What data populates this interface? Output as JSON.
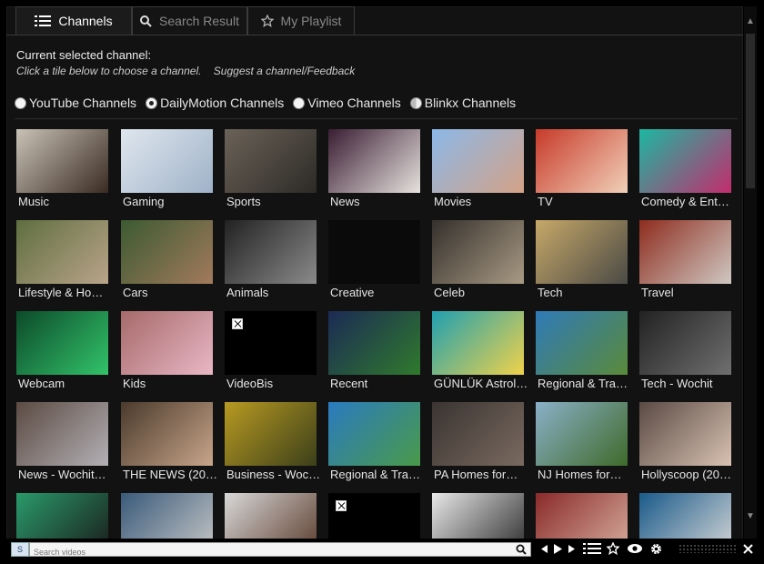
{
  "tabs": [
    {
      "label": "Channels",
      "icon": "list-icon",
      "active": true
    },
    {
      "label": "Search Result",
      "icon": "search-icon",
      "active": false
    },
    {
      "label": "My Playlist",
      "icon": "star-icon",
      "active": false
    }
  ],
  "header": {
    "current_label": "Current selected channel:",
    "hint": "Click a tile below to choose a channel.",
    "suggest_link": "Suggest a channel/Feedback"
  },
  "sources": [
    {
      "label": "YouTube Channels",
      "selected": false
    },
    {
      "label": "DailyMotion Channels",
      "selected": true
    },
    {
      "label": "Vimeo Channels",
      "selected": false
    },
    {
      "label": "Blinkx Channels",
      "selected": false
    }
  ],
  "tiles": [
    {
      "label": "Music",
      "colors": [
        "#c9c2b6",
        "#3a2b22"
      ]
    },
    {
      "label": "Gaming",
      "colors": [
        "#dfe6ee",
        "#9fb2c8"
      ]
    },
    {
      "label": "Sports",
      "colors": [
        "#6b6258",
        "#2c2a26"
      ]
    },
    {
      "label": "News",
      "colors": [
        "#3a1d33",
        "#e6e2de"
      ]
    },
    {
      "label": "Movies",
      "colors": [
        "#8cb8e8",
        "#d4a287"
      ]
    },
    {
      "label": "TV",
      "colors": [
        "#c73a2a",
        "#f1d0b8"
      ]
    },
    {
      "label": "Comedy & Ent…",
      "colors": [
        "#1bb8a2",
        "#c32c6d"
      ]
    },
    {
      "label": "Lifestyle & Ho…",
      "colors": [
        "#5f6e3f",
        "#b9a48a"
      ]
    },
    {
      "label": "Cars",
      "colors": [
        "#3c5a32",
        "#a27a5c"
      ]
    },
    {
      "label": "Animals",
      "colors": [
        "#222",
        "#8a8a8a"
      ]
    },
    {
      "label": "Creative",
      "colors": [
        "#0a0a0a",
        "#0a0a0a"
      ]
    },
    {
      "label": "Celeb",
      "colors": [
        "#35302c",
        "#a89a84"
      ]
    },
    {
      "label": "Tech",
      "colors": [
        "#c6a868",
        "#4b4a46"
      ]
    },
    {
      "label": "Travel",
      "colors": [
        "#8e2c1e",
        "#cfc8c2"
      ]
    },
    {
      "label": "Webcam",
      "colors": [
        "#0c4a2a",
        "#33c36a"
      ]
    },
    {
      "label": "Kids",
      "colors": [
        "#a66a6a",
        "#e9b7c5"
      ]
    },
    {
      "label": "VideoBis",
      "colors": [
        "#000",
        "#000"
      ],
      "broken": true
    },
    {
      "label": "Recent",
      "colors": [
        "#1c2a55",
        "#2f7a2d"
      ]
    },
    {
      "label": "GÜNLÜK Astrol…",
      "colors": [
        "#1fa0b0",
        "#f0d24a"
      ]
    },
    {
      "label": "Regional & Tra…",
      "colors": [
        "#2f7ab8",
        "#5a8a3a"
      ]
    },
    {
      "label": "Tech - Wochit",
      "colors": [
        "#222",
        "#6f6f6f"
      ]
    },
    {
      "label": "News - Wochit…",
      "colors": [
        "#5b4a42",
        "#b3b0b5"
      ]
    },
    {
      "label": "THE NEWS (20…",
      "colors": [
        "#4a3a2c",
        "#c8a58a"
      ]
    },
    {
      "label": "Business - Woc…",
      "colors": [
        "#b89a22",
        "#3b3f1a"
      ]
    },
    {
      "label": "Regional & Tra…",
      "colors": [
        "#2a7ac0",
        "#4a9a4a"
      ]
    },
    {
      "label": "PA Homes for…",
      "colors": [
        "#3a3431",
        "#7a6a60"
      ]
    },
    {
      "label": "NJ Homes for…",
      "colors": [
        "#8ab0c8",
        "#3f6a2a"
      ]
    },
    {
      "label": "Hollyscoop (20…",
      "colors": [
        "#5a4a44",
        "#d8c2b2"
      ]
    },
    {
      "label": "",
      "colors": [
        "#2a9a6a",
        "#1a1a1a"
      ]
    },
    {
      "label": "",
      "colors": [
        "#3a5a7a",
        "#c8c8c8"
      ]
    },
    {
      "label": "",
      "colors": [
        "#d8d8d8",
        "#5a3a2a"
      ]
    },
    {
      "label": "",
      "colors": [
        "#000",
        "#000"
      ],
      "broken": true
    },
    {
      "label": "",
      "colors": [
        "#e8e8e8",
        "#2a2a2a"
      ]
    },
    {
      "label": "",
      "colors": [
        "#8a2a2a",
        "#d8b0a0"
      ]
    },
    {
      "label": "",
      "colors": [
        "#1a5a8a",
        "#d8d8d8"
      ]
    }
  ],
  "search": {
    "placeholder": "Search videos"
  },
  "logo_text": "S"
}
